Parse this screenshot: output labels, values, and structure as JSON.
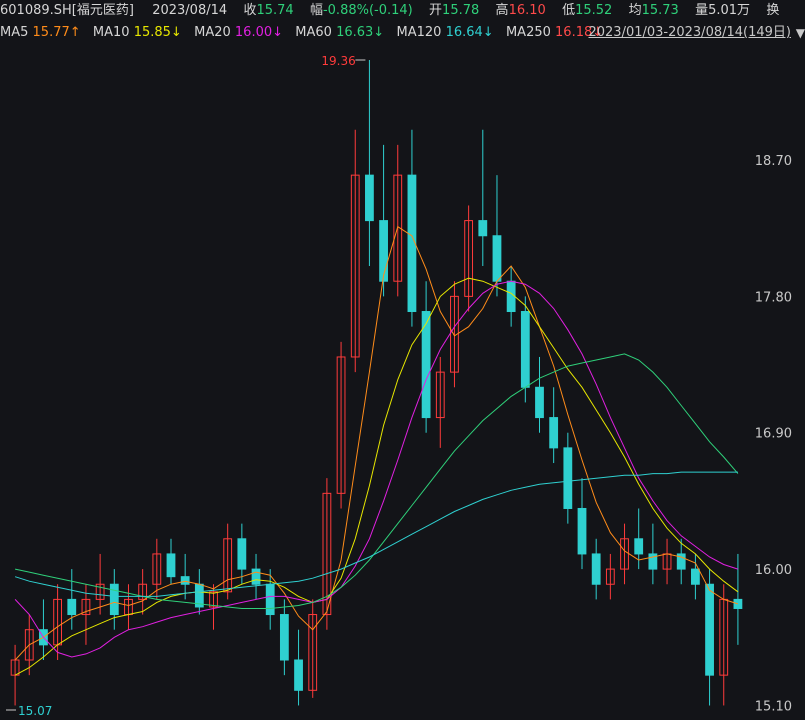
{
  "header": {
    "code": "601089.SH[福元医药]",
    "date": "2023/08/14",
    "close_label": "收",
    "close": "15.74",
    "change_label": "幅",
    "change": "-0.88%(-0.14)",
    "open_label": "开",
    "open": "15.78",
    "high_label": "高",
    "high": "16.10",
    "low_label": "低",
    "low": "15.52",
    "avg_label": "均",
    "avg": "15.73",
    "vol_label": "量",
    "vol": "5.01万",
    "turnover_label": "换"
  },
  "ma_bar": {
    "ma5_label": "MA5",
    "ma5": "15.77↑",
    "ma10_label": "MA10",
    "ma10": "15.85↓",
    "ma20_label": "MA20",
    "ma20": "16.00↓",
    "ma60_label": "MA60",
    "ma60": "16.63↓",
    "ma120_label": "MA120",
    "ma120": "16.64↓",
    "ma250_label": "MA250",
    "ma250": "16.18↓",
    "range": "2023/01/03-2023/08/14(149日)",
    "dropdown": "▼"
  },
  "colors": {
    "up": "#ff3b3b",
    "down": "#2fd0d0",
    "ma5": "#ff8c1a",
    "ma10": "#e6e600",
    "ma20": "#e020e0",
    "ma60": "#2fd07a",
    "ma120": "#2fd0d0",
    "ma250": "#ff4a4a",
    "grid": "#3a3a3a",
    "bg": "#131418"
  },
  "chart_data": {
    "type": "candlestick",
    "ylim": [
      15.07,
      19.36
    ],
    "yticks": [
      "18.70",
      "17.80",
      "16.90",
      "16.00",
      "15.10"
    ],
    "annotations": {
      "max": "19.36",
      "min": "15.07"
    },
    "ohlc_sample": [
      [
        15.3,
        15.5,
        15.1,
        15.4
      ],
      [
        15.4,
        15.7,
        15.3,
        15.6
      ],
      [
        15.6,
        15.8,
        15.4,
        15.5
      ],
      [
        15.5,
        15.9,
        15.4,
        15.8
      ],
      [
        15.8,
        16.0,
        15.6,
        15.7
      ],
      [
        15.7,
        15.9,
        15.5,
        15.8
      ],
      [
        15.8,
        16.1,
        15.7,
        15.9
      ],
      [
        15.9,
        16.0,
        15.6,
        15.7
      ],
      [
        15.7,
        15.9,
        15.6,
        15.8
      ],
      [
        15.8,
        16.0,
        15.7,
        15.9
      ],
      [
        15.9,
        16.2,
        15.8,
        16.1
      ],
      [
        16.1,
        16.2,
        15.9,
        15.95
      ],
      [
        15.95,
        16.1,
        15.8,
        15.9
      ],
      [
        15.9,
        16.0,
        15.7,
        15.75
      ],
      [
        15.75,
        15.9,
        15.6,
        15.85
      ],
      [
        15.85,
        16.3,
        15.8,
        16.2
      ],
      [
        16.2,
        16.3,
        15.9,
        16.0
      ],
      [
        16.0,
        16.1,
        15.8,
        15.9
      ],
      [
        15.9,
        16.0,
        15.6,
        15.7
      ],
      [
        15.7,
        15.8,
        15.3,
        15.4
      ],
      [
        15.4,
        15.6,
        15.1,
        15.2
      ],
      [
        15.2,
        15.8,
        15.15,
        15.7
      ],
      [
        15.7,
        16.6,
        15.6,
        16.5
      ],
      [
        16.5,
        17.5,
        16.4,
        17.4
      ],
      [
        17.4,
        18.9,
        17.3,
        18.6
      ],
      [
        18.6,
        19.36,
        18.0,
        18.3
      ],
      [
        18.3,
        18.8,
        17.8,
        17.9
      ],
      [
        17.9,
        18.8,
        17.8,
        18.6
      ],
      [
        18.6,
        18.9,
        17.6,
        17.7
      ],
      [
        17.7,
        17.9,
        16.9,
        17.0
      ],
      [
        17.0,
        17.4,
        16.8,
        17.3
      ],
      [
        17.3,
        17.9,
        17.2,
        17.8
      ],
      [
        17.8,
        18.4,
        17.7,
        18.3
      ],
      [
        18.3,
        18.9,
        18.0,
        18.2
      ],
      [
        18.2,
        18.6,
        17.8,
        17.9
      ],
      [
        17.9,
        18.0,
        17.6,
        17.7
      ],
      [
        17.7,
        17.8,
        17.1,
        17.2
      ],
      [
        17.2,
        17.4,
        16.9,
        17.0
      ],
      [
        17.0,
        17.2,
        16.7,
        16.8
      ],
      [
        16.8,
        16.9,
        16.3,
        16.4
      ],
      [
        16.4,
        16.6,
        16.0,
        16.1
      ],
      [
        16.1,
        16.2,
        15.8,
        15.9
      ],
      [
        15.9,
        16.1,
        15.8,
        16.0
      ],
      [
        16.0,
        16.3,
        15.9,
        16.2
      ],
      [
        16.2,
        16.4,
        16.0,
        16.1
      ],
      [
        16.1,
        16.3,
        15.9,
        16.0
      ],
      [
        16.0,
        16.2,
        15.9,
        16.1
      ],
      [
        16.1,
        16.2,
        15.9,
        16.0
      ],
      [
        16.0,
        16.1,
        15.8,
        15.9
      ],
      [
        15.9,
        16.0,
        15.1,
        15.3
      ],
      [
        15.3,
        15.9,
        15.1,
        15.8
      ],
      [
        15.8,
        16.1,
        15.5,
        15.74
      ]
    ],
    "ma": {
      "ma5": [
        15.4,
        15.5,
        15.55,
        15.62,
        15.68,
        15.72,
        15.75,
        15.78,
        15.76,
        15.79,
        15.86,
        15.9,
        15.92,
        15.9,
        15.87,
        15.93,
        15.95,
        15.98,
        15.96,
        15.84,
        15.69,
        15.6,
        15.72,
        16.06,
        16.68,
        17.3,
        17.94,
        18.26,
        18.2,
        17.98,
        17.7,
        17.54,
        17.6,
        17.72,
        17.9,
        18.0,
        17.86,
        17.6,
        17.34,
        17.02,
        16.72,
        16.44,
        16.24,
        16.12,
        16.06,
        16.08,
        16.1,
        16.08,
        16.04,
        15.86,
        15.8,
        15.77
      ],
      "ma10": [
        15.3,
        15.35,
        15.42,
        15.5,
        15.56,
        15.6,
        15.64,
        15.68,
        15.7,
        15.72,
        15.78,
        15.82,
        15.84,
        15.85,
        15.84,
        15.86,
        15.9,
        15.93,
        15.92,
        15.88,
        15.82,
        15.78,
        15.8,
        15.94,
        16.2,
        16.55,
        16.95,
        17.25,
        17.48,
        17.62,
        17.8,
        17.88,
        17.92,
        17.9,
        17.86,
        17.82,
        17.74,
        17.6,
        17.46,
        17.32,
        17.2,
        17.05,
        16.9,
        16.74,
        16.56,
        16.4,
        16.27,
        16.17,
        16.1,
        16.0,
        15.92,
        15.85
      ],
      "ma20": [
        15.8,
        15.7,
        15.55,
        15.45,
        15.42,
        15.44,
        15.48,
        15.55,
        15.6,
        15.62,
        15.65,
        15.68,
        15.7,
        15.72,
        15.74,
        15.76,
        15.78,
        15.8,
        15.82,
        15.82,
        15.8,
        15.78,
        15.8,
        15.88,
        16.02,
        16.2,
        16.45,
        16.72,
        17.0,
        17.25,
        17.45,
        17.6,
        17.72,
        17.82,
        17.88,
        17.9,
        17.88,
        17.82,
        17.72,
        17.58,
        17.42,
        17.22,
        17.0,
        16.8,
        16.6,
        16.45,
        16.32,
        16.22,
        16.15,
        16.08,
        16.03,
        16.0
      ],
      "ma60": [
        16.0,
        15.98,
        15.96,
        15.94,
        15.92,
        15.9,
        15.88,
        15.86,
        15.84,
        15.82,
        15.8,
        15.79,
        15.78,
        15.77,
        15.76,
        15.75,
        15.74,
        15.74,
        15.74,
        15.75,
        15.76,
        15.78,
        15.82,
        15.88,
        15.96,
        16.06,
        16.18,
        16.3,
        16.42,
        16.54,
        16.66,
        16.78,
        16.88,
        16.98,
        17.06,
        17.14,
        17.2,
        17.26,
        17.3,
        17.34,
        17.36,
        17.38,
        17.4,
        17.42,
        17.38,
        17.3,
        17.2,
        17.08,
        16.96,
        16.84,
        16.74,
        16.63
      ],
      "ma120": [
        15.95,
        15.92,
        15.9,
        15.88,
        15.86,
        15.84,
        15.83,
        15.82,
        15.82,
        15.82,
        15.82,
        15.83,
        15.84,
        15.85,
        15.86,
        15.87,
        15.88,
        15.89,
        15.9,
        15.91,
        15.92,
        15.94,
        15.97,
        16.0,
        16.04,
        16.08,
        16.13,
        16.18,
        16.23,
        16.28,
        16.33,
        16.38,
        16.42,
        16.46,
        16.49,
        16.52,
        16.54,
        16.56,
        16.57,
        16.58,
        16.59,
        16.6,
        16.61,
        16.62,
        16.62,
        16.63,
        16.63,
        16.64,
        16.64,
        16.64,
        16.64,
        16.64
      ]
    }
  }
}
